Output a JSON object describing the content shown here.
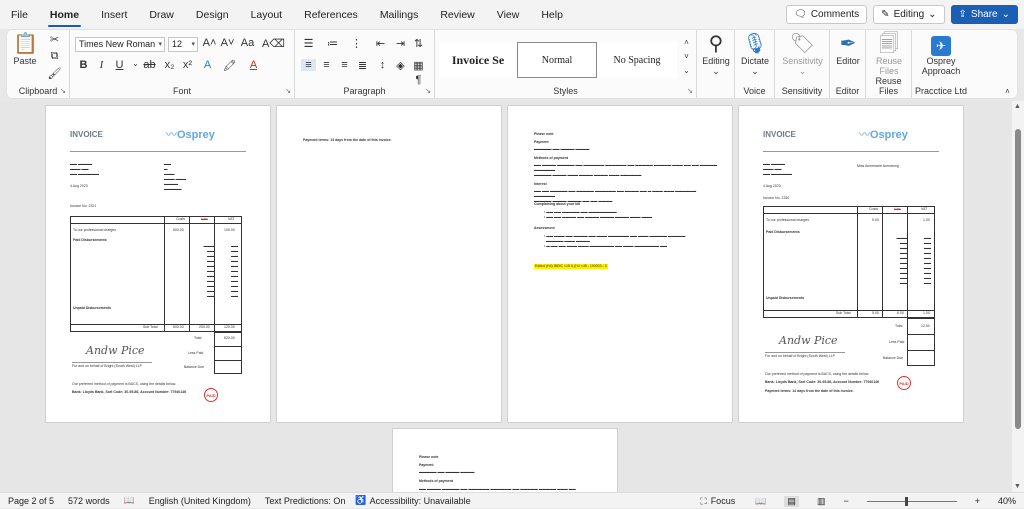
{
  "menu": {
    "tabs": [
      "File",
      "Home",
      "Insert",
      "Draw",
      "Design",
      "Layout",
      "References",
      "Mailings",
      "Review",
      "View",
      "Help"
    ],
    "active": "Home",
    "comments_label": "Comments",
    "editing_label": "Editing",
    "share_label": "Share"
  },
  "ribbon": {
    "clipboard": {
      "paste_label": "Paste",
      "group_label": "Clipboard"
    },
    "font": {
      "family": "Times New Roman",
      "size": "12",
      "group_label": "Font"
    },
    "paragraph": {
      "group_label": "Paragraph"
    },
    "styles": {
      "items": [
        "Invoice Se",
        "Normal",
        "No Spacing"
      ],
      "group_label": "Styles"
    },
    "editing": {
      "label": "Editing"
    },
    "voice": {
      "dictate_label": "Dictate",
      "group_label": "Voice"
    },
    "sensitivity": {
      "label": "Sensitivity",
      "group_label": "Sensitivity"
    },
    "editor": {
      "label": "Editor",
      "group_label": "Editor"
    },
    "reuse": {
      "label_line1": "Reuse",
      "label_line2": "Files",
      "group_label": "Reuse Files"
    },
    "osprey": {
      "label_line1": "Osprey",
      "label_line2": "Approach",
      "group_label": "Pracctice Ltd"
    }
  },
  "doc": {
    "invoice_title": "INVOICE",
    "logo_text": "Osprey",
    "invoice_no_label": "Invoice No:",
    "invoice_no": "2321",
    "invoice_no_4": "2330",
    "date": "4 Aug 2023",
    "costs_label": "Costs",
    "vat_label": "VAT",
    "vat_strike": "Vatx",
    "prof_charges": "To our professional charges",
    "prof_cost": "500.00",
    "prof_vat": "100.00",
    "prof_cost_4": "5.00",
    "prof_vat_4": "1.00",
    "paid_disb": "Paid Disbursements",
    "unpaid_disb": "Unpaid Disbursements",
    "subtotal_label": "Sub Total",
    "subtotal_cost": "500.00",
    "subtotal_mid": "200.00",
    "subtotal_vat": "120.00",
    "subtotal_cost_4": "5.00",
    "subtotal_mid_4": "6.00",
    "subtotal_vat_4": "1.00",
    "total_label": "Total",
    "total_val": "820.00",
    "total_val_4": "12.00",
    "less_paid": "Less Paid",
    "balance_due": "Balance Due",
    "signed_for": "For and on behalf of Bright (South West) LLP",
    "bacs_text": "Our preferred method of payment is BACS, using the details below.",
    "bank_line": "Bank:   Lloyds Bank, Sort Code: 30-95-86, Account Number: 77940146",
    "payment_terms": "Payment terms: 14 days from the date of this invoice.",
    "recipient_4": "Miss Annemarie Armstrong",
    "please_note": "Please note",
    "payment_h": "Payment",
    "method_h": "Methods of payment",
    "interest_h": "Interest",
    "complaints_h": "Complaining about your bill",
    "assessment_h": "Assessment",
    "highlight_ref": "Edited (H4) IBDIC  ×18 & (H4 ×48 - 190003 - 3",
    "stamp": "PAID"
  },
  "status": {
    "page": "Page 2 of 5",
    "words": "572 words",
    "language": "English (United Kingdom)",
    "predictions": "Text Predictions: On",
    "accessibility": "Accessibility: Unavailable",
    "focus": "Focus",
    "zoom": "40%"
  }
}
